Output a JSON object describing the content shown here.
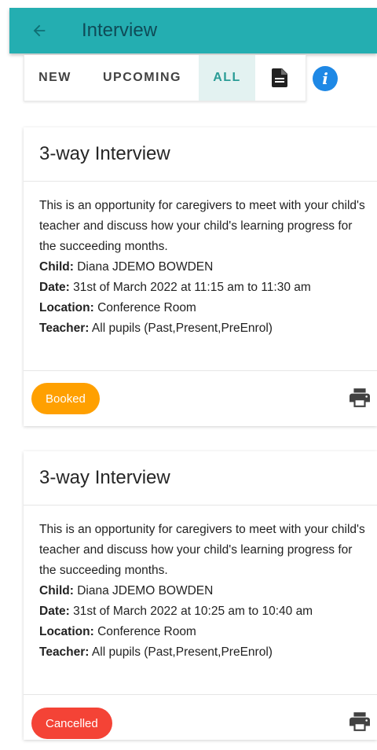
{
  "appbar": {
    "title": "Interview"
  },
  "tabs": [
    {
      "label": "NEW"
    },
    {
      "label": "UPCOMING"
    },
    {
      "label": "ALL"
    }
  ],
  "cards": [
    {
      "title": "3-way Interview",
      "description": "This is an opportunity for caregivers to meet with your child's teacher and discuss how your child's learning progress for the succeeding months.",
      "child_label": "Child:",
      "child": "Diana JDEMO BOWDEN",
      "date_label": "Date:",
      "date": "31st of March 2022 at 11:15 am to 11:30 am",
      "location_label": "Location:",
      "location": "Conference Room",
      "teacher_label": "Teacher:",
      "teacher": "All pupils (Past,Present,PreEnrol)",
      "status": "Booked",
      "status_color": "#ffa000"
    },
    {
      "title": "3-way Interview",
      "description": "This is an opportunity for caregivers to meet with your child's teacher and discuss how your child's learning progress for the succeeding months.",
      "child_label": "Child:",
      "child": "Diana JDEMO BOWDEN",
      "date_label": "Date:",
      "date": "31st of March 2022 at 10:25 am to 10:40 am",
      "location_label": "Location:",
      "location": "Conference Room",
      "teacher_label": "Teacher:",
      "teacher": "All pupils (Past,Present,PreEnrol)",
      "status": "Cancelled",
      "status_color": "#f44336"
    }
  ],
  "colors": {
    "accent": "#24aeb1",
    "title_text": "#0f4b57",
    "active_tab": "#2a9c96",
    "info": "#1e88e5"
  },
  "icons": [
    "arrow-left-icon",
    "document-icon",
    "info-icon",
    "print-icon"
  ]
}
